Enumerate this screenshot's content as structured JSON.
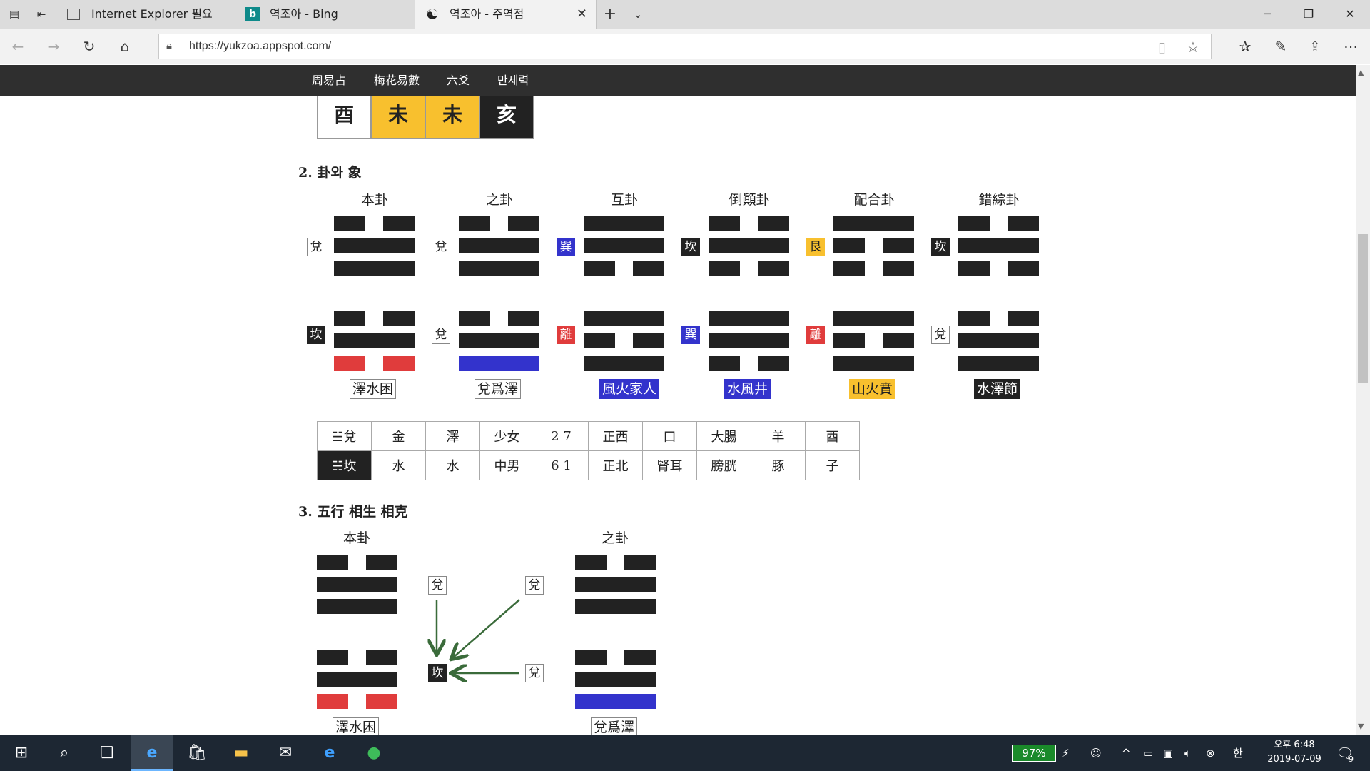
{
  "browser": {
    "tabs": [
      {
        "label": "Internet Explorer 필요",
        "active": false
      },
      {
        "label": "역조아 - Bing",
        "active": false
      },
      {
        "label": "역조아 - 주역점",
        "active": true
      }
    ],
    "url": "https://yukzoa.appspot.com/"
  },
  "site_menu": [
    "周易占",
    "梅花易數",
    "六爻",
    "만세력"
  ],
  "top_row": [
    {
      "char": "酉",
      "style": "white"
    },
    {
      "char": "未",
      "style": "yellow"
    },
    {
      "char": "未",
      "style": "yellow"
    },
    {
      "char": "亥",
      "style": "black"
    }
  ],
  "section2": {
    "heading": "2. 卦와 象",
    "columns": [
      {
        "label": "本卦",
        "upper": {
          "char": "兌",
          "style": "white"
        },
        "lower": {
          "char": "坎",
          "style": "black"
        },
        "name": "澤水困",
        "name_style": "white",
        "lines": [
          [
            "y",
            "#222"
          ],
          [
            "Y",
            "#222"
          ],
          [
            "Y",
            "#222"
          ],
          [
            "y",
            "#222"
          ],
          [
            "Y",
            "#222"
          ],
          [
            "y",
            "#e03c3c"
          ]
        ]
      },
      {
        "label": "之卦",
        "upper": {
          "char": "兌",
          "style": "white"
        },
        "lower": {
          "char": "兌",
          "style": "white"
        },
        "name": "兌爲澤",
        "name_style": "white",
        "lines": [
          [
            "y",
            "#222"
          ],
          [
            "Y",
            "#222"
          ],
          [
            "Y",
            "#222"
          ],
          [
            "y",
            "#222"
          ],
          [
            "Y",
            "#222"
          ],
          [
            "Y",
            "#3333cc"
          ]
        ]
      },
      {
        "label": "互卦",
        "upper": {
          "char": "巽",
          "style": "blue"
        },
        "lower": {
          "char": "離",
          "style": "red"
        },
        "name": "風火家人",
        "name_style": "blue",
        "lines": [
          [
            "Y",
            "#222"
          ],
          [
            "Y",
            "#222"
          ],
          [
            "y",
            "#222"
          ],
          [
            "Y",
            "#222"
          ],
          [
            "y",
            "#222"
          ],
          [
            "Y",
            "#222"
          ]
        ]
      },
      {
        "label": "倒顚卦",
        "upper": {
          "char": "坎",
          "style": "black"
        },
        "lower": {
          "char": "巽",
          "style": "blue"
        },
        "name": "水風井",
        "name_style": "blue",
        "lines": [
          [
            "y",
            "#222"
          ],
          [
            "Y",
            "#222"
          ],
          [
            "y",
            "#222"
          ],
          [
            "Y",
            "#222"
          ],
          [
            "Y",
            "#222"
          ],
          [
            "y",
            "#222"
          ]
        ]
      },
      {
        "label": "配合卦",
        "upper": {
          "char": "艮",
          "style": "yellow"
        },
        "lower": {
          "char": "離",
          "style": "red"
        },
        "name": "山火賁",
        "name_style": "yellow",
        "lines": [
          [
            "Y",
            "#222"
          ],
          [
            "y",
            "#222"
          ],
          [
            "y",
            "#222"
          ],
          [
            "Y",
            "#222"
          ],
          [
            "y",
            "#222"
          ],
          [
            "Y",
            "#222"
          ]
        ]
      },
      {
        "label": "錯綜卦",
        "upper": {
          "char": "坎",
          "style": "black"
        },
        "lower": {
          "char": "兌",
          "style": "white"
        },
        "name": "水澤節",
        "name_style": "black",
        "lines": [
          [
            "y",
            "#222"
          ],
          [
            "Y",
            "#222"
          ],
          [
            "y",
            "#222"
          ],
          [
            "y",
            "#222"
          ],
          [
            "Y",
            "#222"
          ],
          [
            "Y",
            "#222"
          ]
        ]
      }
    ],
    "table": [
      [
        "☱兌",
        "金",
        "澤",
        "少女",
        "2 7",
        "正西",
        "口",
        "大腸",
        "羊",
        "酉"
      ],
      [
        "☵坎",
        "水",
        "水",
        "中男",
        "6 1",
        "正北",
        "腎耳",
        "膀胱",
        "豚",
        "子"
      ]
    ]
  },
  "section3": {
    "heading": "3. 五行 相生 相克",
    "left_label": "本卦",
    "right_label": "之卦",
    "left_name": "澤水困",
    "right_name": "兌爲澤",
    "diagram": {
      "a": "兌",
      "b": "兌",
      "c": "坎",
      "d": "兌"
    },
    "left_lines": [
      [
        "y",
        "#222"
      ],
      [
        "Y",
        "#222"
      ],
      [
        "Y",
        "#222"
      ],
      [
        "y",
        "#222"
      ],
      [
        "Y",
        "#222"
      ],
      [
        "y",
        "#e03c3c"
      ]
    ],
    "right_lines": [
      [
        "y",
        "#222"
      ],
      [
        "Y",
        "#222"
      ],
      [
        "Y",
        "#222"
      ],
      [
        "y",
        "#222"
      ],
      [
        "Y",
        "#222"
      ],
      [
        "Y",
        "#3333cc"
      ]
    ]
  },
  "taskbar": {
    "battery": "97%",
    "ime": "한",
    "time": "오후 6:48",
    "date": "2019-07-09",
    "notifications": "9"
  }
}
